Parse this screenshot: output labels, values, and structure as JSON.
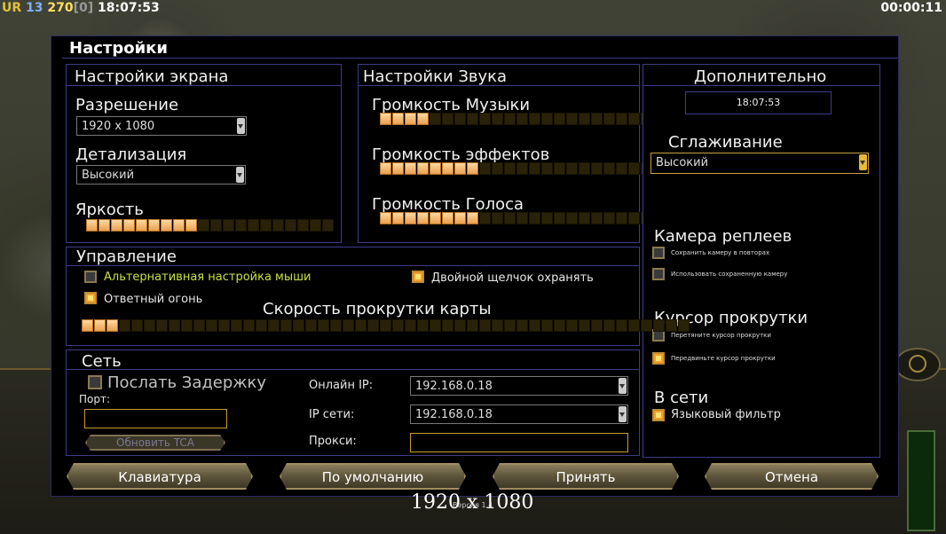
{
  "hud": {
    "ur": "UR",
    "lvl": "13",
    "money": "270",
    "bracket": "[0]",
    "clock": "18:07:53",
    "timer": "00:00:11"
  },
  "title": "Настройки",
  "screen": {
    "header": "Настройки экрана",
    "resolution_label": "Разрешение",
    "resolution_value": "1920 x 1080",
    "detail_label": "Детализация",
    "detail_value": "Высокий",
    "brightness_label": "Яркость",
    "brightness_level": 0.45
  },
  "sound": {
    "header": "Настройки Звука",
    "music_label": "Громкость Музыки",
    "music_level": 0.18,
    "effects_label": "Громкость эффектов",
    "effects_level": 0.35,
    "voice_label": "Громкость Голоса",
    "voice_level": 0.35
  },
  "extra": {
    "header": "Дополнительно",
    "time": "18:07:53",
    "antialias_label": "Сглаживание",
    "antialias_value": "Высокий",
    "replay_header": "Камера реплеев",
    "replay_opt1": "Сохранить камеру в повторах",
    "replay_opt2": "Использовать сохраненную камеру",
    "cursor_header": "Курсор прокрутки",
    "cursor_opt1": "Перетяните курсор прокрутки",
    "cursor_opt2": "Передвиньте курсор прокрутки",
    "online_header": "В сети",
    "lang_filter": "Языковый фильтр"
  },
  "control": {
    "header": "Управление",
    "alt_mouse": "Альтернативная настройка мыши",
    "double_click": "Двойной щелчок охранять",
    "return_fire": "Ответный огонь",
    "scroll_label": "Скорость прокрутки карты",
    "scroll_level": 0.06
  },
  "network": {
    "header": "Сеть",
    "send_delay": "Послать Задержку",
    "port_label": "Порт:",
    "update_btn": "Обновить TCA",
    "online_ip_label": "Онлайн IP:",
    "online_ip_value": "192.168.0.18",
    "lan_ip_label": "IP сети:",
    "lan_ip_value": "192.168.0.18",
    "proxy_label": "Прокси:"
  },
  "buttons": {
    "keyboard": "Клавиатура",
    "defaults": "По умолчанию",
    "accept": "Принять",
    "cancel": "Отмена"
  },
  "footer": {
    "resolution": "1920 x 1080",
    "version": "Версия 1.4"
  }
}
